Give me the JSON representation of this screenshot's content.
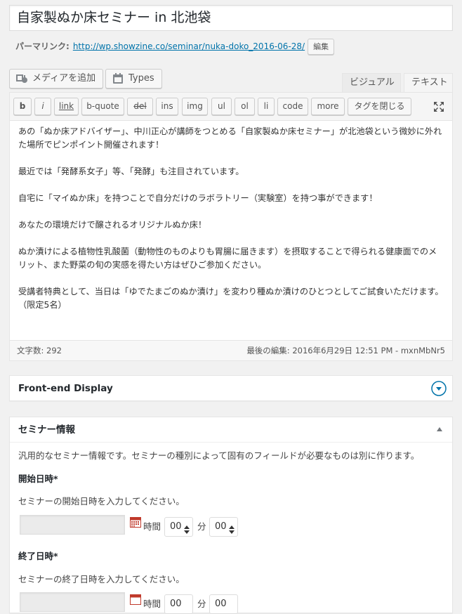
{
  "title": "自家製ぬか床セミナー in 北池袋",
  "permalink": {
    "label": "パーマリンク:",
    "url": "http://wp.showzine.co/seminar/nuka-doko_2016-06-28/",
    "edit_label": "編集"
  },
  "media_buttons": {
    "add_media": "メディアを追加",
    "types": "Types"
  },
  "editor_tabs": {
    "visual": "ビジュアル",
    "text": "テキスト"
  },
  "quicktags": [
    "b",
    "i",
    "link",
    "b-quote",
    "del",
    "ins",
    "img",
    "ul",
    "ol",
    "li",
    "code",
    "more",
    "タグを閉じる"
  ],
  "content": {
    "p1": "あの「ぬか床アドバイザー」、中川正心が講師をつとめる「自家製ぬか床セミナー」が北池袋という微妙に外れた場所でピンポイント開催されます！",
    "p2": "最近では「発酵系女子」等、「発酵」も注目されています。",
    "p3": "自宅に「マイぬか床」を持つことで自分だけのラボラトリー（実験室）を持つ事ができます！",
    "p4": "あなたの環境だけで醸されるオリジナルぬか床！",
    "p5": "ぬか漬けによる植物性乳酸菌（動物性のものよりも胃腸に届きます）を摂取することで得られる健康面でのメリット、また野菜の旬の実感を得たい方はぜひご参加ください。",
    "p6": "受講者特典として、当日は「ゆでたまごのぬか漬け」を変わり種ぬか漬けのひとつとしてご試食いただけます。（限定5名）"
  },
  "status": {
    "word_count": "文字数: 292",
    "last_edit": "最後の編集: 2016年6月29日 12:51 PM - mxnMbNr5"
  },
  "front_end_box": {
    "title": "Front-end Display"
  },
  "seminar_box": {
    "title": "セミナー情報",
    "description": "汎用的なセミナー情報です。セミナーの種別によって固有のフィールドが必要なものは別に作ります。",
    "start": {
      "label": "開始日時*",
      "help": "セミナーの開始日時を入力してください。",
      "hour_unit": "時間",
      "hour_value": "00",
      "minute_unit": "分",
      "minute_value": "00"
    },
    "end": {
      "label": "終了日時*",
      "help": "セミナーの終了日時を入力してください。",
      "hour_unit": "時間",
      "hour_value": "00",
      "minute_unit": "分",
      "minute_value": "00"
    }
  },
  "colors": {
    "link": "#0073aa",
    "toggle_blue": "#0073aa",
    "calendar_red": "#c0392b"
  }
}
